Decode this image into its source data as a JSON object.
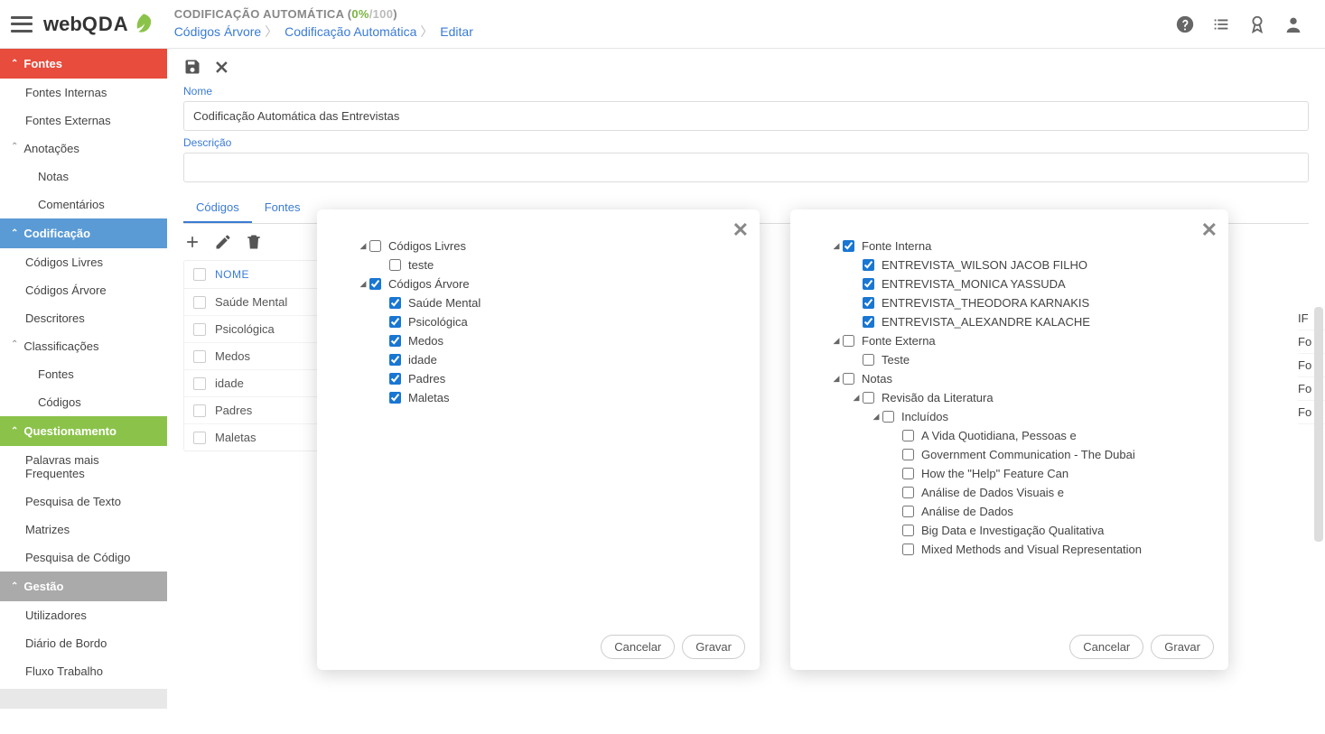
{
  "header": {
    "title": "CODIFICAÇÃO AUTOMÁTICA",
    "progress_pct": "0%",
    "progress_total": "/100",
    "breadcrumb": [
      "Códigos Árvore",
      "Codificação Automática",
      "Editar"
    ]
  },
  "sidebar": {
    "fontes": {
      "label": "Fontes",
      "items": [
        "Fontes Internas",
        "Fontes Externas"
      ]
    },
    "anotacoes": {
      "label": "Anotações",
      "items": [
        "Notas",
        "Comentários"
      ]
    },
    "codificacao": {
      "label": "Codificação",
      "items": [
        "Códigos Livres",
        "Códigos Árvore",
        "Descritores"
      ]
    },
    "classificacoes": {
      "label": "Classificações",
      "items": [
        "Fontes",
        "Códigos"
      ]
    },
    "questionamento": {
      "label": "Questionamento",
      "items": [
        "Palavras mais Frequentes",
        "Pesquisa de Texto",
        "Matrizes",
        "Pesquisa de Código"
      ]
    },
    "gestao": {
      "label": "Gestão",
      "items": [
        "Utilizadores",
        "Diário de Bordo",
        "Fluxo Trabalho"
      ]
    }
  },
  "form": {
    "nome_label": "Nome",
    "nome_value": "Codificação Automática das Entrevistas",
    "desc_label": "Descrição",
    "desc_value": ""
  },
  "tabs": [
    "Códigos",
    "Fontes"
  ],
  "table": {
    "header": "NOME",
    "rows": [
      "Saúde Mental",
      "Psicológica",
      "Medos",
      "idade",
      "Padres",
      "Maletas"
    ]
  },
  "peek_rows": [
    "IF",
    "Fo",
    "Fo",
    "Fo",
    "Fo"
  ],
  "modal_codes": {
    "btn_cancel": "Cancelar",
    "btn_save": "Gravar",
    "tree": [
      {
        "d": 0,
        "exp": true,
        "chk": false,
        "label": "Códigos Livres"
      },
      {
        "d": 1,
        "exp": false,
        "chk": false,
        "label": "teste",
        "noTri": true
      },
      {
        "d": 0,
        "exp": true,
        "chk": true,
        "label": "Códigos Árvore"
      },
      {
        "d": 1,
        "chk": true,
        "label": "Saúde Mental",
        "noTri": true
      },
      {
        "d": 1,
        "chk": true,
        "label": "Psicológica",
        "noTri": true
      },
      {
        "d": 1,
        "chk": true,
        "label": "Medos",
        "noTri": true
      },
      {
        "d": 1,
        "chk": true,
        "label": "idade",
        "noTri": true
      },
      {
        "d": 1,
        "chk": true,
        "label": "Padres",
        "noTri": true
      },
      {
        "d": 1,
        "chk": true,
        "label": "Maletas",
        "noTri": true
      }
    ]
  },
  "modal_fontes": {
    "btn_cancel": "Cancelar",
    "btn_save": "Gravar",
    "tree": [
      {
        "d": 0,
        "exp": true,
        "chk": true,
        "label": "Fonte Interna"
      },
      {
        "d": 1,
        "chk": true,
        "label": "ENTREVISTA_WILSON JACOB FILHO",
        "noTri": true
      },
      {
        "d": 1,
        "chk": true,
        "label": "ENTREVISTA_MONICA YASSUDA",
        "noTri": true
      },
      {
        "d": 1,
        "chk": true,
        "label": "ENTREVISTA_THEODORA KARNAKIS",
        "noTri": true
      },
      {
        "d": 1,
        "chk": true,
        "label": "ENTREVISTA_ALEXANDRE KALACHE",
        "noTri": true
      },
      {
        "d": 0,
        "exp": true,
        "chk": false,
        "label": "Fonte Externa"
      },
      {
        "d": 1,
        "chk": false,
        "label": "Teste",
        "noTri": true
      },
      {
        "d": 0,
        "exp": true,
        "chk": false,
        "label": "Notas"
      },
      {
        "d": 1,
        "exp": true,
        "chk": false,
        "label": "Revisão da Literatura"
      },
      {
        "d": 2,
        "exp": true,
        "chk": false,
        "label": "Incluídos"
      },
      {
        "d": 3,
        "chk": false,
        "label": "A Vida Quotidiana, Pessoas e",
        "noTri": true
      },
      {
        "d": 3,
        "chk": false,
        "label": "Government Communication - The Dubai",
        "noTri": true
      },
      {
        "d": 3,
        "chk": false,
        "label": "How the \"Help\" Feature Can",
        "noTri": true
      },
      {
        "d": 3,
        "chk": false,
        "label": "Análise de Dados Visuais e",
        "noTri": true
      },
      {
        "d": 3,
        "chk": false,
        "label": "Análise de Dados",
        "noTri": true
      },
      {
        "d": 3,
        "chk": false,
        "label": "Big Data e Investigação Qualitativa",
        "noTri": true
      },
      {
        "d": 3,
        "chk": false,
        "label": "Mixed Methods and Visual Representation",
        "noTri": true
      }
    ]
  }
}
